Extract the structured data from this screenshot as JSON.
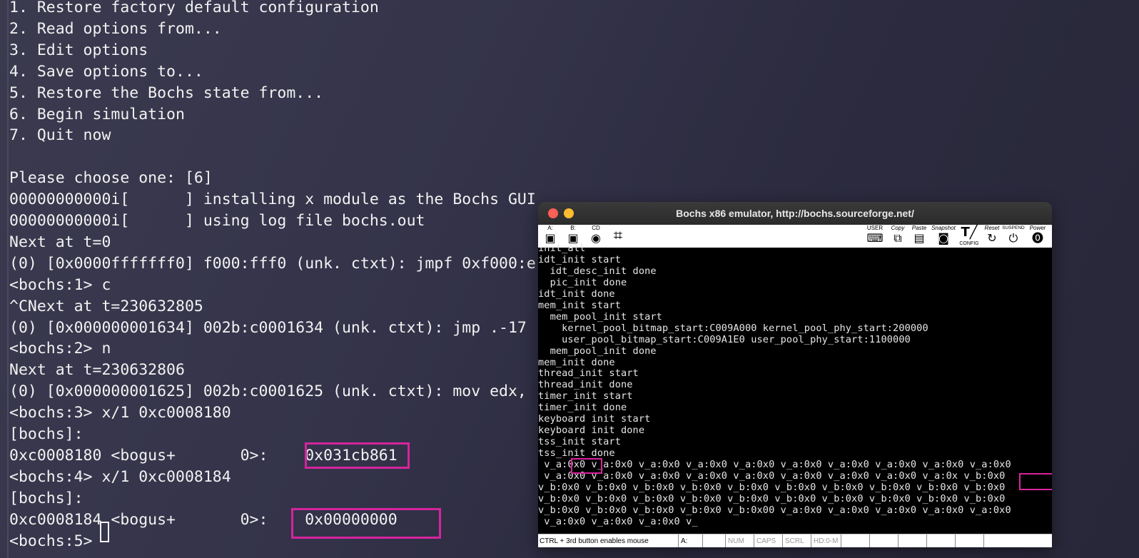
{
  "terminal": {
    "lines": [
      "1. Restore factory default configuration",
      "2. Read options from...",
      "3. Edit options",
      "4. Save options to...",
      "5. Restore the Bochs state from...",
      "6. Begin simulation",
      "7. Quit now",
      "",
      "Please choose one: [6]",
      "00000000000i[      ] installing x module as the Bochs GUI",
      "00000000000i[      ] using log file bochs.out",
      "Next at t=0",
      "(0) [0x0000fffffff0] f000:fff0 (unk. ctxt): jmpf 0xf000:e",
      "<bochs:1> c",
      "^CNext at t=230632805",
      "(0) [0x000000001634] 002b:c0001634 (unk. ctxt): jmp .-17",
      "<bochs:2> n",
      "Next at t=230632806",
      "(0) [0x000000001625] 002b:c0001625 (unk. ctxt): mov edx,",
      "<bochs:3> x/1 0xc0008180",
      "[bochs]:",
      "0xc0008180 <bogus+       0>:    0x031cb861",
      "<bochs:4> x/1 0xc0008184",
      "[bochs]:",
      "0xc0008184 <bogus+       0>:    0x00000000",
      "<bochs:5> "
    ]
  },
  "bochs_window": {
    "title": "Bochs x86 emulator, http://bochs.sourceforge.net/",
    "toolbar": {
      "floppy_a": "A:",
      "floppy_b": "B:",
      "cdrom": "CD",
      "user": "USER",
      "copy": "Copy",
      "paste": "Paste",
      "snapshot": "Snapshot",
      "config": "CONFIG",
      "reset": "Reset",
      "suspend": "SUSPEND",
      "power": "Power"
    },
    "screen_lines": [
      "init_all",
      "idt_init start",
      "  idt_desc_init done",
      "  pic_init done",
      "idt_init done",
      "mem_init start",
      "  mem_pool_init start",
      "    kernel_pool_bitmap_start:C009A000 kernel_pool_phy_start:200000",
      "    user_pool_bitmap_start:C009A1E0 user_pool_phy_start:1100000",
      "  mem_pool_init done",
      "mem_init done",
      "thread_init start",
      "thread_init done",
      "timer_init start",
      "timer_init done",
      "keyboard init start",
      "keyboard init done",
      "tss_init start",
      "tss_init done",
      " v_a:0x0 v_a:0x0 v_a:0x0 v_a:0x0 v_a:0x0 v_a:0x0 v_a:0x0 v_a:0x0 v_a:0x0 v_a:0x0",
      " v_a:0x0 v_a:0x0 v_a:0x0 v_a:0x0 v_a:0x0 v_a:0x0 v_a:0x0 v_a:0x0 v_a:0x v_b:0x0",
      "v_b:0x0 v_b:0x0 v_b:0x0 v_b:0x0 v_b:0x0 v_b:0x0 v_b:0x0 v_b:0x0 v_b:0x0 v_b:0x0",
      "v_b:0x0 v_b:0x0 v_b:0x0 v_b:0x0 v_b:0x0 v_b:0x0 v_b:0x0 v_b:0x0 v_b:0x0 v_b:0x0",
      "v_b:0x0 v_b:0x0 v_b:0x0 v_b:0x0 v_b:0x00 v_a:0x0 v_a:0x0 v_a:0x0 v_a:0x0 v_a:0x0",
      " v_a:0x0 v_a:0x0 v_a:0x0 v_"
    ],
    "statusbar": {
      "mouse_hint": "CTRL + 3rd button enables mouse",
      "drive_a": "A:",
      "num": "NUM",
      "caps": "CAPS",
      "scrl": "SCRL",
      "hd": "HD:0-M"
    }
  },
  "colors": {
    "highlight": "#d6249d",
    "terminal_text": "#f2f2f2",
    "terminal_bg": "#34334a"
  },
  "icons": [
    "floppy-icon",
    "cdrom-icon",
    "mouse-icon",
    "keyboard-icon",
    "copy-icon",
    "paste-icon",
    "camera-icon",
    "config-icon",
    "reset-icon",
    "power-icon"
  ]
}
